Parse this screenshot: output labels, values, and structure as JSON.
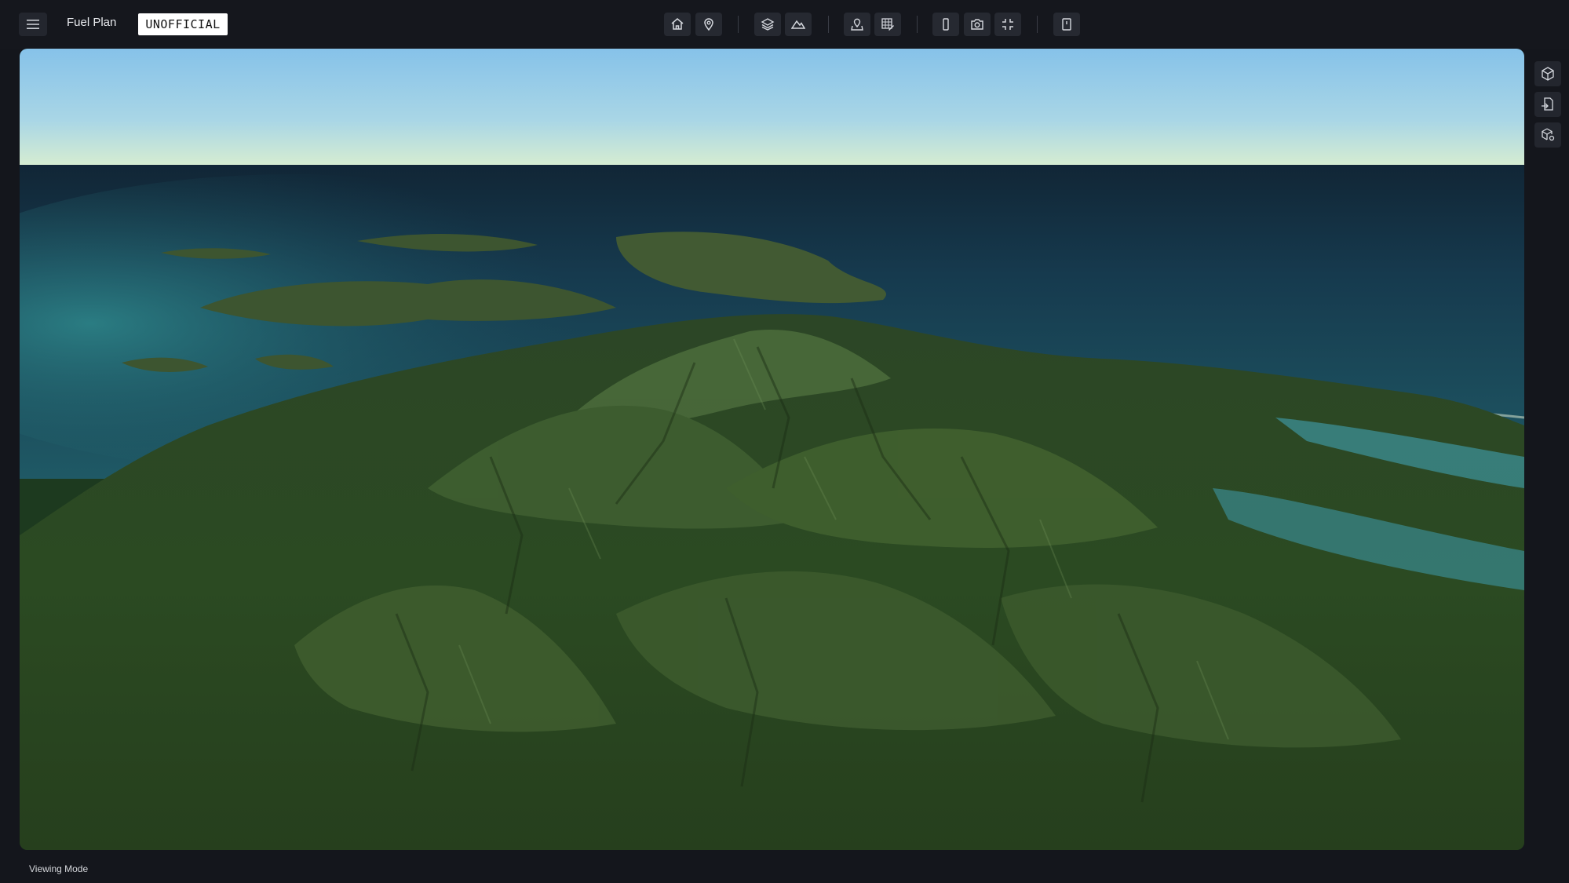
{
  "header": {
    "app_title": "Fuel Plan",
    "classification_badge": "UNOFFICIAL"
  },
  "toolbar": {
    "groups": [
      [
        "home-icon",
        "location-pin-icon"
      ],
      [
        "layers-icon",
        "terrain-icon"
      ],
      [
        "map-pin-icon",
        "grid-edit-icon"
      ],
      [
        "split-view-icon",
        "camera-icon",
        "fullscreen-exit-icon"
      ],
      [
        "panel-icon"
      ]
    ]
  },
  "right_sidebar": {
    "icons": [
      "cube-icon",
      "file-export-icon",
      "cube-settings-icon"
    ]
  },
  "viewport": {
    "content": "3d-terrain-view"
  },
  "status": {
    "mode_label": "Viewing Mode"
  },
  "colors": {
    "background": "#14161c",
    "button": "#262931",
    "badge_bg": "#ffffff"
  }
}
